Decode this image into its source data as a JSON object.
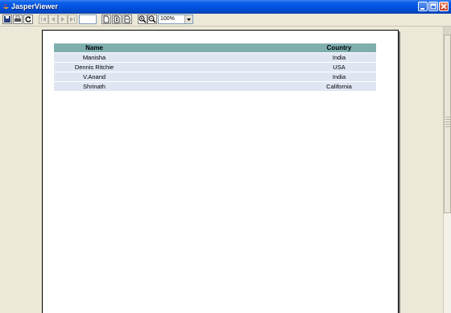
{
  "window": {
    "title": "JasperViewer"
  },
  "toolbar": {
    "buttons": [
      "save-icon",
      "print-icon",
      "reload-icon",
      "first-page-icon",
      "previous-page-icon",
      "next-page-icon",
      "last-page-icon",
      "actual-size-icon",
      "fit-page-icon",
      "fit-width-icon",
      "zoom-in-icon",
      "zoom-out-icon"
    ],
    "page_number": "",
    "zoom_value": "100%"
  },
  "report": {
    "columns": {
      "name": "Name",
      "country": "Country"
    },
    "rows": [
      {
        "name": "Manisha",
        "country": "India"
      },
      {
        "name": "Dennis Ritchie",
        "country": "USA"
      },
      {
        "name": "V.Anand",
        "country": "India"
      },
      {
        "name": "Shrinath",
        "country": "California"
      }
    ]
  },
  "colors": {
    "header_bg": "#7faeae",
    "row_bg": "#dfe6f2",
    "titlebar": "#0054e3"
  }
}
